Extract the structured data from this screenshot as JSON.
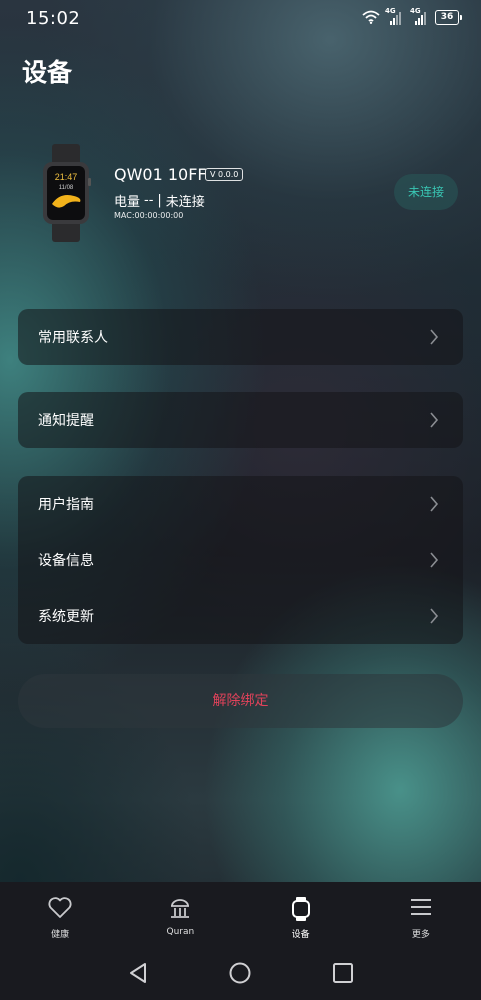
{
  "status_bar": {
    "time": "15:02",
    "sim1_label": "4G",
    "sim2_label": "4G",
    "battery": "36"
  },
  "page": {
    "title": "设备"
  },
  "device": {
    "watch_time": "21:47",
    "watch_date": "11/08",
    "name": "QW01 10FF",
    "version": "V 0.0.0",
    "power_label": "电量",
    "power_value": "--",
    "separator": "|",
    "status": "未连接",
    "mac": "MAC:00:00:00:00",
    "connect_button": "未连接"
  },
  "menu_groups": [
    {
      "items": [
        {
          "label": "常用联系人"
        }
      ]
    },
    {
      "items": [
        {
          "label": "通知提醒"
        }
      ]
    },
    {
      "items": [
        {
          "label": "用户指南"
        },
        {
          "label": "设备信息"
        },
        {
          "label": "系统更新"
        }
      ]
    }
  ],
  "unbind_button": "解除绑定",
  "bottom_nav": [
    {
      "label": "健康",
      "icon": "heart-icon"
    },
    {
      "label": "Quran",
      "icon": "mosque-icon"
    },
    {
      "label": "设备",
      "icon": "watch-icon",
      "active": true
    },
    {
      "label": "更多",
      "icon": "menu-icon"
    }
  ],
  "colors": {
    "accent": "#39c6b4",
    "danger": "#e0425a",
    "nav_bg": "#191a1f"
  }
}
